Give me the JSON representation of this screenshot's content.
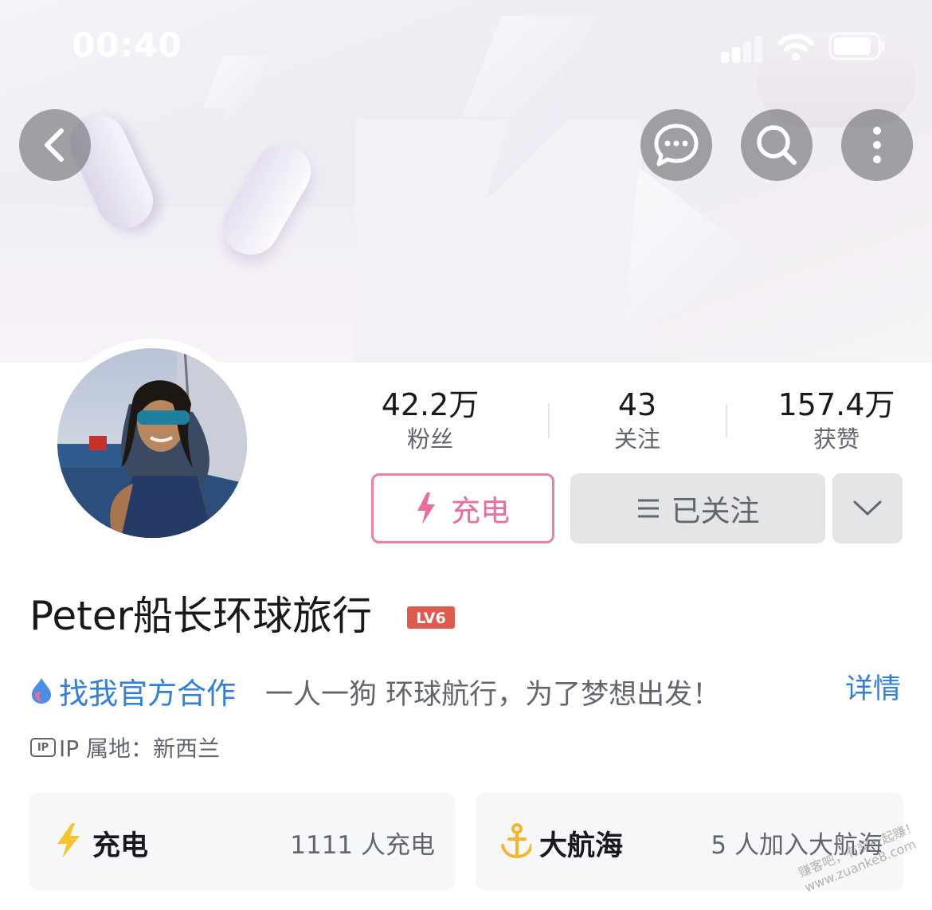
{
  "status_bar": {
    "time": "00:40"
  },
  "profile": {
    "name": "Peter船长环球旅行",
    "level": "LV6",
    "stats": [
      {
        "value": "42.2万",
        "label": "粉丝"
      },
      {
        "value": "43",
        "label": "关注"
      },
      {
        "value": "157.4万",
        "label": "获赞"
      }
    ],
    "charge_button_label": "充电",
    "follow_button_label": "已关注",
    "coop_link": "找我官方合作",
    "bio": "一人一狗 环球航行，为了梦想出发！",
    "detail_link": "详情",
    "ip_badge": "IP",
    "ip_location": "IP 属地：新西兰"
  },
  "cards": [
    {
      "title": "充电",
      "note": "1111 人充电"
    },
    {
      "title": "大航海",
      "note": "5 人加入大航海"
    }
  ],
  "watermark": "赚客吧，有奖一起赚！www.zuanke8.com",
  "colors": {
    "accent_pink": "#eb6d9a",
    "link_blue": "#2f7fde",
    "level_red": "#e05a4f"
  }
}
